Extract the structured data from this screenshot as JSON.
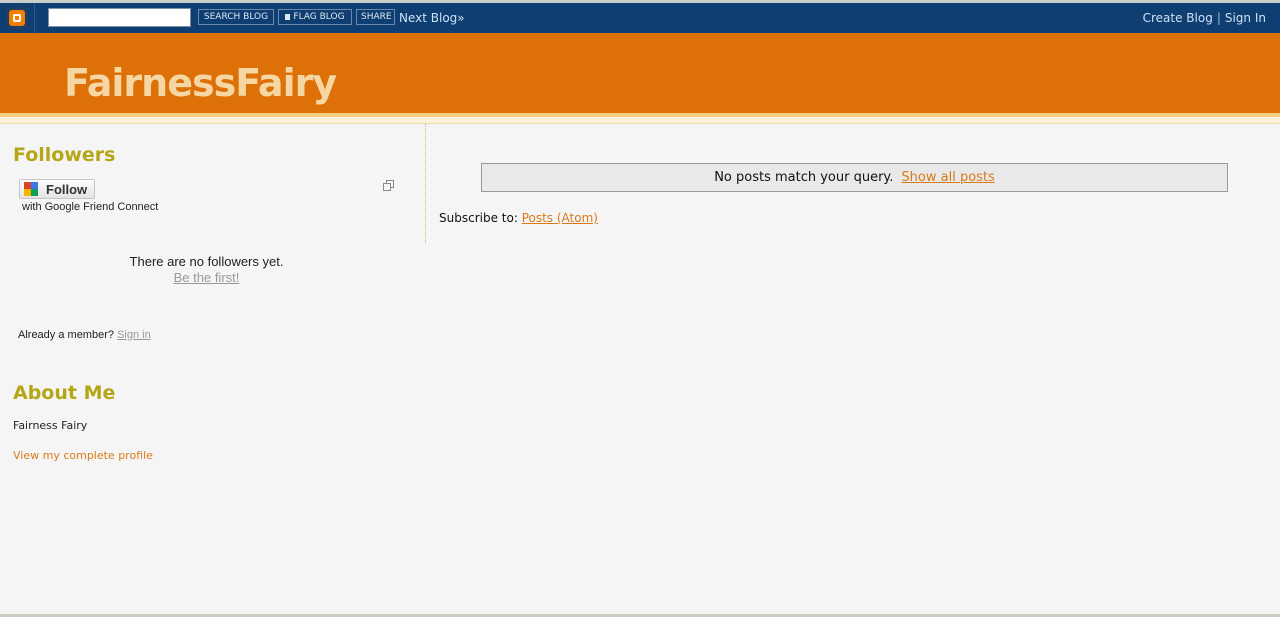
{
  "navbar": {
    "search_placeholder": "",
    "search_blog_label": "SEARCH BLOG",
    "flag_blog_label": "FLAG BLOG",
    "share_label": "SHARE",
    "next_blog_label": "Next Blog»",
    "create_blog_label": "Create Blog",
    "separator": "|",
    "sign_in_label": "Sign In"
  },
  "header": {
    "blog_title": "FairnessFairy"
  },
  "sidebar": {
    "followers": {
      "title": "Followers",
      "follow_button_label": "Follow",
      "friend_connect_text": "with Google Friend Connect",
      "no_followers_text": "There are no followers yet.",
      "be_first_link": "Be the first!",
      "already_member_text": "Already a member?",
      "sign_in_link": "Sign in"
    },
    "about": {
      "title": "About Me",
      "author_name": "Fairness Fairy",
      "profile_link": "View my complete profile"
    }
  },
  "main": {
    "status_message": "No posts match your query.",
    "show_all_link": "Show all posts",
    "subscribe_label": "Subscribe to:",
    "subscribe_link": "Posts (Atom)"
  },
  "colors": {
    "navbar_bg": "#0f3f72",
    "header_bg": "#de7008",
    "title_color": "#f6d7a4",
    "heading_color": "#b5a615",
    "link_color": "#d87a1a",
    "page_bg": "#f5f5f5"
  }
}
